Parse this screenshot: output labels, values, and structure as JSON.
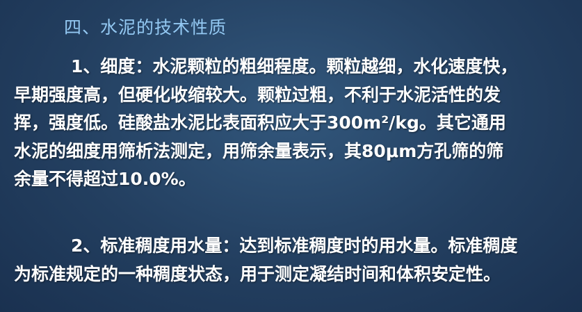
{
  "heading": "四、水泥的技术性质",
  "paragraph1": {
    "lines": [
      "1、细度：水泥颗粒的粗细程度。颗粒越细，水化速度快，",
      "早期强度高，但硬化收缩较大。颗粒过粗，不利于水泥活性的发",
      "挥，强度低。硅酸盐水泥比表面积应大于300m²/kg。其它通用",
      "水泥的细度用筛析法测定，用筛余量表示，其80μm方孔筛的筛",
      "余量不得超过10.0%。"
    ]
  },
  "paragraph2": {
    "lines": [
      "2、标准稠度用水量：达到标准稠度时的用水量。标准稠度",
      "为标准规定的一种稠度状态，用于测定凝结时间和体积安定性。"
    ]
  },
  "colors": {
    "background": "#233f60",
    "heading": "#93c8f2",
    "body_text": "#ffffff"
  }
}
